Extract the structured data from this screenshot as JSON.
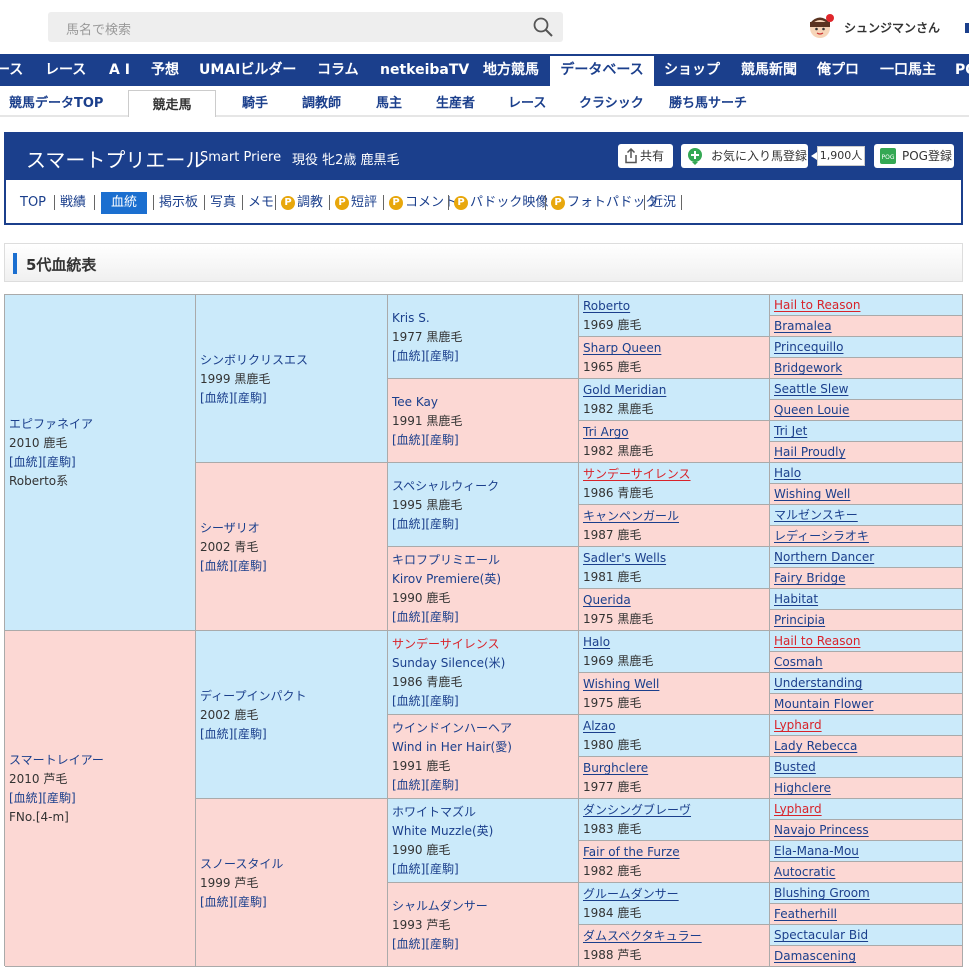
{
  "header": {
    "search_placeholder": "馬名で検索",
    "user_name": "シュンジマンさん"
  },
  "main_nav": [
    "ース",
    "レース",
    "A I",
    "予想",
    "UMAIビルダー",
    "コラム",
    "netkeibaTV",
    "地方競馬",
    "データベース",
    "ショップ",
    "競馬新聞",
    "俺プロ",
    "一口馬主",
    "PO"
  ],
  "sub_nav": [
    "競馬データTOP",
    "競走馬",
    "騎手",
    "調教師",
    "馬主",
    "生産者",
    "レース",
    "クラシック",
    "勝ち馬サーチ"
  ],
  "horse": {
    "name": "スマートプリエール",
    "name_en": "Smart Priere",
    "info": "現役 牝2歳 鹿黒毛",
    "share_label": "共有",
    "favorite_label": "お気に入り馬登録",
    "favorite_count": "1,900人",
    "pog_label": "POG登録"
  },
  "horse_tabs": [
    "TOP",
    "戦績",
    "血統",
    "掲示板",
    "写真",
    "メモ",
    "調教",
    "短評",
    "コメント",
    "パドック映像",
    "フォトパドック",
    "近況"
  ],
  "section_title": "5代血統表",
  "link_text": "[血統][産駒]",
  "pedigree": {
    "g1": [
      {
        "name": "エピファネイア",
        "year": "2010 鹿毛",
        "extra": "Roberto系"
      },
      {
        "name": "スマートレイアー",
        "year": "2010 芦毛",
        "extra": "FNo.[4-m]"
      }
    ],
    "g2": [
      {
        "name": "シンボリクリスエス",
        "year": "1999 黒鹿毛"
      },
      {
        "name": "シーザリオ",
        "year": "2002 青毛"
      },
      {
        "name": "ディープインパクト",
        "year": "2002 鹿毛"
      },
      {
        "name": "スノースタイル",
        "year": "1999 芦毛"
      }
    ],
    "g3": [
      {
        "name": "Kris S.",
        "en": "",
        "year": "1977 黒鹿毛"
      },
      {
        "name": "Tee Kay",
        "en": "",
        "year": "1991 黒鹿毛"
      },
      {
        "name": "スペシャルウィーク",
        "en": "",
        "year": "1995 黒鹿毛"
      },
      {
        "name": "キロフプリミエール",
        "en": "Kirov Premiere(英)",
        "year": "1990 鹿毛"
      },
      {
        "name": "サンデーサイレンス",
        "en": "Sunday Silence(米)",
        "year": "1986 青鹿毛"
      },
      {
        "name": "ウインドインハーヘア",
        "en": "Wind in Her Hair(愛)",
        "year": "1991 鹿毛"
      },
      {
        "name": "ホワイトマズル",
        "en": "White Muzzle(英)",
        "year": "1990 鹿毛"
      },
      {
        "name": "シャルムダンサー",
        "en": "",
        "year": "1993 芦毛"
      }
    ],
    "g4": [
      {
        "name": "Roberto",
        "year": "1969 鹿毛"
      },
      {
        "name": "Sharp Queen",
        "year": "1965 鹿毛"
      },
      {
        "name": "Gold Meridian",
        "year": "1982 黒鹿毛"
      },
      {
        "name": "Tri Argo",
        "year": "1982 黒鹿毛"
      },
      {
        "name": "サンデーサイレンス",
        "year": "1986 青鹿毛"
      },
      {
        "name": "キャンペンガール",
        "year": "1987 鹿毛"
      },
      {
        "name": "Sadler's Wells",
        "year": "1981 鹿毛"
      },
      {
        "name": "Querida",
        "year": "1975 黒鹿毛"
      },
      {
        "name": "Halo",
        "year": "1969 黒鹿毛"
      },
      {
        "name": "Wishing Well",
        "year": "1975 鹿毛"
      },
      {
        "name": "Alzao",
        "year": "1980 鹿毛"
      },
      {
        "name": "Burghclere",
        "year": "1977 鹿毛"
      },
      {
        "name": "ダンシングブレーヴ",
        "year": "1983 鹿毛"
      },
      {
        "name": "Fair of the Furze",
        "year": "1982 鹿毛"
      },
      {
        "name": "グルームダンサー",
        "year": "1984 鹿毛"
      },
      {
        "name": "ダムスペクタキュラー",
        "year": "1988 芦毛"
      }
    ],
    "g5": [
      "Hail to Reason",
      "Bramalea",
      "Princequillo",
      "Bridgework",
      "Seattle Slew",
      "Queen Louie",
      "Tri Jet",
      "Hail Proudly",
      "Halo",
      "Wishing Well",
      "マルゼンスキー",
      "レディーシラオキ",
      "Northern Dancer",
      "Fairy Bridge",
      "Habitat",
      "Principia",
      "Hail to Reason",
      "Cosmah",
      "Understanding",
      "Mountain Flower",
      "Lyphard",
      "Lady Rebecca",
      "Busted",
      "Highclere",
      "Lyphard",
      "Navajo Princess",
      "Ela-Mana-Mou",
      "Autocratic",
      "Blushing Groom",
      "Featherhill",
      "Spectacular Bid",
      "Damascening"
    ]
  },
  "colors": {
    "nav": "#1b3f8c",
    "male_cell": "#cbeafa",
    "female_cell": "#fcd8d4",
    "highlight_name": "#d8232a"
  }
}
